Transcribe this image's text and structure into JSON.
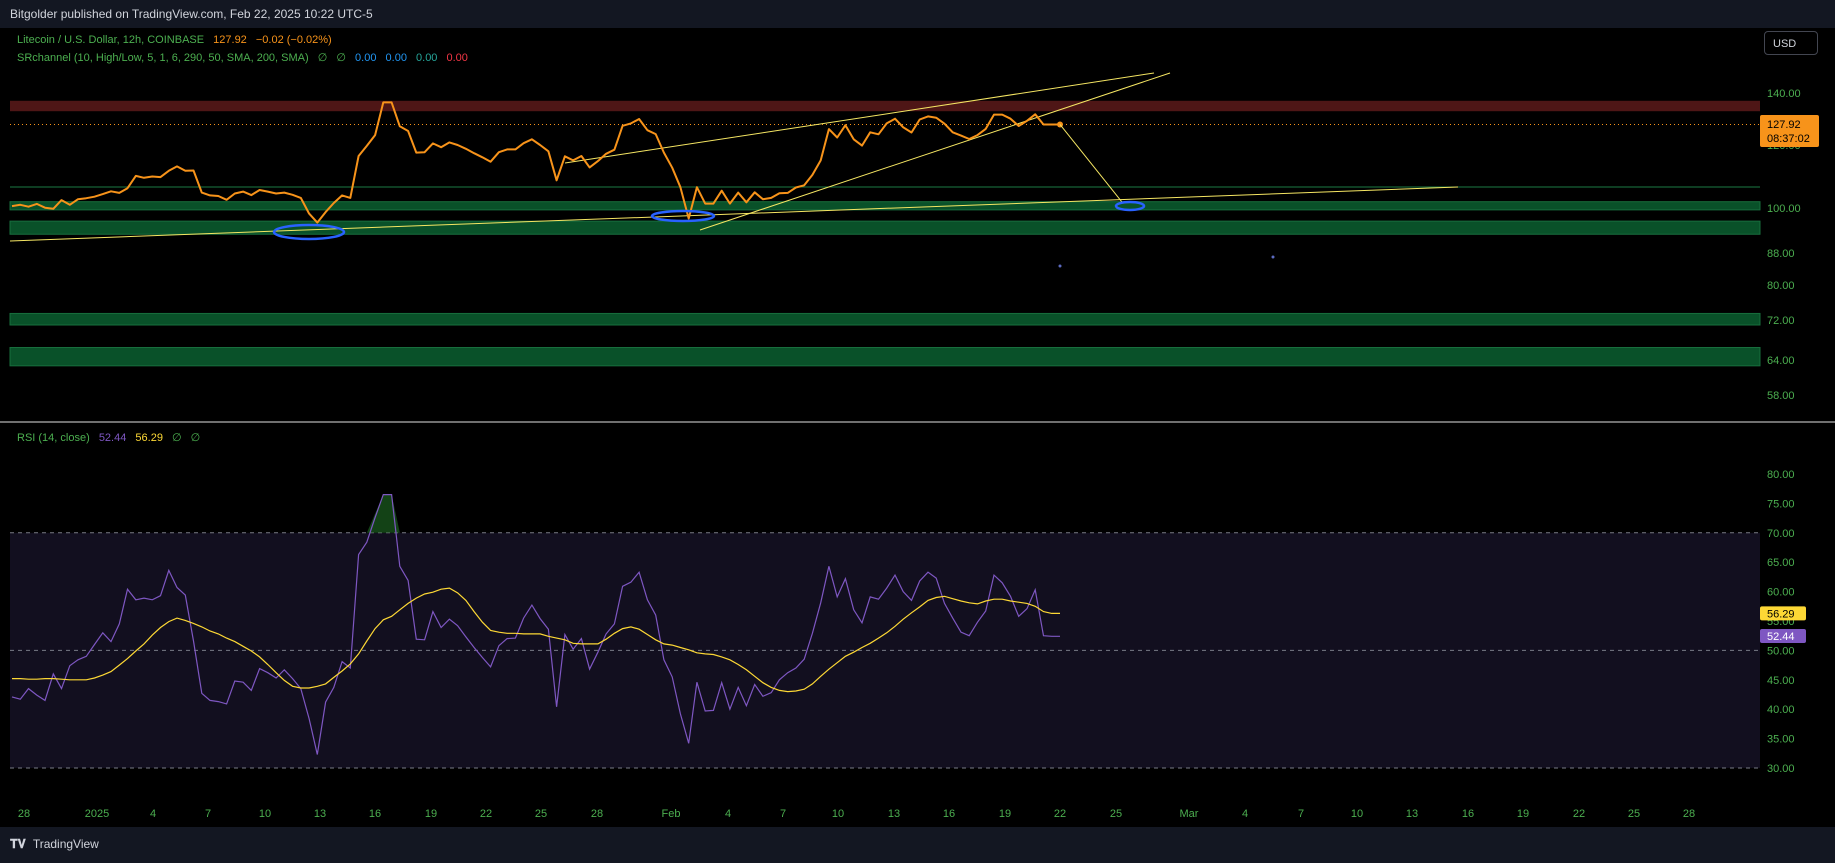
{
  "header": {
    "publisher": "Bitgolder published on TradingView.com, Feb 22, 2025 10:22 UTC-5"
  },
  "currency_button": "USD",
  "legend": {
    "symbol": "Litecoin / U.S. Dollar, 12h, COINBASE",
    "price": "127.92",
    "change": "−0.02 (−0.02%)",
    "indicator": "SRchannel (10, High/Low, 5, 1, 6, 290, 50, SMA, 200, SMA)",
    "indicator_values": [
      "0.00",
      "0.00",
      "0.00",
      "0.00"
    ],
    "rsi_label": "RSI (14, close)",
    "rsi_value": "52.44",
    "rsi_ma_value": "56.29",
    "empty_glyph": "∅"
  },
  "price_badge": {
    "price": "127.92",
    "countdown": "08:37:02"
  },
  "rsi_badges": {
    "ma": "56.29",
    "rsi": "52.44"
  },
  "colors": {
    "price_line": "#f7931a",
    "trendline": "#f5e663",
    "rsi_line": "#7e57c2",
    "rsi_ma": "#fdd835",
    "support_zone": "#0a5a2e",
    "resistance_zone": "#5c1a1a",
    "axis_text": "#4caf50",
    "ellipse": "#2962ff"
  },
  "footer": {
    "brand": "TradingView"
  },
  "chart_data": [
    {
      "type": "line",
      "title": "Litecoin / U.S. Dollar, 12h, COINBASE",
      "y_ticks": [
        "140.00",
        "120.00",
        "100.00",
        "88.00",
        "80.00",
        "72.00",
        "64.00",
        "58.00"
      ],
      "x_tick_labels": [
        "28",
        "2025",
        "4",
        "7",
        "10",
        "13",
        "16",
        "19",
        "22",
        "25",
        "28",
        "Feb",
        "4",
        "7",
        "10",
        "13",
        "16",
        "19",
        "22",
        "25",
        "Mar",
        "4",
        "7",
        "10",
        "13",
        "16",
        "19",
        "22",
        "25",
        "28"
      ],
      "series": [
        {
          "name": "Litecoin / U.S. Dollar",
          "values": [
            100.6,
            101.0,
            100.4,
            101.3,
            100.1,
            99.8,
            102.5,
            101.0,
            102.8,
            103.1,
            103.6,
            104.4,
            105.3,
            104.8,
            106.3,
            110.2,
            109.6,
            110.0,
            109.8,
            111.8,
            113.2,
            111.8,
            111.9,
            104.9,
            104.0,
            103.8,
            102.6,
            104.6,
            105.2,
            104.1,
            105.7,
            105.2,
            104.6,
            104.9,
            104.2,
            103.2,
            98.5,
            96.1,
            98.9,
            101.6,
            104.0,
            103.2,
            116.5,
            119.7,
            123.8,
            136.4,
            136.4,
            127.2,
            125.4,
            117.6,
            117.7,
            120.6,
            119.3,
            121.0,
            120.0,
            118.8,
            117.4,
            116.1,
            114.7,
            117.7,
            118.6,
            118.6,
            120.7,
            122.2,
            120.0,
            118.0,
            108.8,
            116.4,
            115.1,
            116.5,
            112.9,
            114.9,
            117.2,
            118.5,
            127.4,
            128.3,
            130.0,
            125.7,
            124.2,
            117.6,
            112.8,
            106.6,
            97.2,
            106.6,
            101.4,
            101.4,
            105.5,
            101.4,
            104.9,
            101.8,
            105.0,
            102.8,
            103.2,
            104.7,
            104.8,
            106.5,
            107.2,
            110.5,
            115.1,
            126.1,
            122.9,
            127.6,
            122.2,
            119.8,
            124.9,
            124.1,
            128.3,
            130.1,
            126.8,
            124.8,
            129.8,
            131.0,
            130.5,
            128.2,
            124.9,
            123.6,
            122.3,
            123.8,
            126.2,
            131.7,
            131.7,
            130.1,
            127.3,
            129.3,
            131.8,
            127.9,
            127.9,
            127.9
          ]
        },
        {
          "name": "SRchannel zones",
          "values": []
        }
      ],
      "resistance_zone": [
        133,
        137
      ],
      "support_zones": [
        [
          99.5,
          102
        ],
        [
          93,
          96.5
        ],
        [
          71,
          73.5
        ],
        [
          63,
          66.5
        ]
      ],
      "projection": {
        "from": 127.9,
        "to": 101.5
      },
      "ylim": [
        55,
        155
      ]
    },
    {
      "type": "line",
      "title": "RSI (14, close)",
      "y_ticks": [
        "80.00",
        "75.00",
        "70.00",
        "65.00",
        "60.00",
        "55.00",
        "50.00",
        "45.00",
        "40.00",
        "35.00",
        "30.00"
      ],
      "bands": [
        30,
        50,
        70
      ],
      "series": [
        {
          "name": "RSI",
          "values": [
            42.1,
            41.7,
            43.5,
            42.4,
            41.5,
            46.0,
            43.5,
            47.4,
            48.4,
            49.0,
            51.0,
            53.0,
            51.5,
            54.5,
            60.4,
            58.6,
            58.9,
            58.6,
            59.3,
            63.6,
            60.7,
            59.4,
            51.6,
            42.7,
            41.5,
            41.3,
            40.9,
            44.8,
            44.6,
            43.2,
            46.9,
            46.2,
            45.3,
            46.7,
            45.2,
            43.5,
            38.4,
            32.3,
            41.2,
            43.7,
            48.1,
            47.0,
            66.3,
            68.4,
            72.6,
            76.5,
            76.5,
            64.3,
            61.9,
            51.9,
            51.8,
            56.6,
            53.9,
            55.3,
            54.2,
            52.3,
            50.5,
            48.8,
            47.2,
            50.8,
            52.0,
            52.1,
            55.5,
            57.7,
            55.4,
            53.6,
            40.4,
            52.7,
            50.2,
            52.0,
            46.8,
            49.7,
            52.8,
            54.5,
            60.9,
            61.6,
            63.3,
            58.6,
            56.0,
            48.4,
            45.5,
            39.2,
            34.2,
            44.6,
            39.7,
            39.8,
            44.5,
            40.0,
            43.7,
            40.6,
            44.2,
            42.2,
            42.8,
            45.0,
            46.2,
            47.0,
            48.5,
            52.9,
            58.1,
            64.3,
            59.1,
            62.2,
            56.9,
            54.7,
            59.1,
            58.7,
            60.6,
            62.8,
            60.0,
            58.5,
            61.8,
            63.3,
            62.3,
            58.0,
            55.5,
            53.1,
            52.5,
            54.8,
            56.7,
            62.8,
            61.5,
            59.2,
            55.8,
            57.1,
            60.3,
            52.5,
            52.4,
            52.4
          ]
        },
        {
          "name": "RSI-based MA",
          "values": [
            45.2,
            45.2,
            45.1,
            45.1,
            45.2,
            45.2,
            45.1,
            45.0,
            45.0,
            45.0,
            45.3,
            45.8,
            46.4,
            47.5,
            48.6,
            49.9,
            51.1,
            52.6,
            53.9,
            54.9,
            55.5,
            55.1,
            54.6,
            54.0,
            53.3,
            52.8,
            52.1,
            51.5,
            50.7,
            49.9,
            48.9,
            47.6,
            46.2,
            44.9,
            43.9,
            43.6,
            43.6,
            43.9,
            44.3,
            45.4,
            46.5,
            47.7,
            49.4,
            51.6,
            53.7,
            55.2,
            55.8,
            56.9,
            58.0,
            58.9,
            59.6,
            59.9,
            60.4,
            60.6,
            59.8,
            58.5,
            56.6,
            54.8,
            53.4,
            53.1,
            52.9,
            52.9,
            52.8,
            52.8,
            52.8,
            52.4,
            52.1,
            51.8,
            51.2,
            51.1,
            51.1,
            51.1,
            51.9,
            52.9,
            53.7,
            54.0,
            53.6,
            52.7,
            51.8,
            51.1,
            50.9,
            50.5,
            50.1,
            49.6,
            49.4,
            49.3,
            48.9,
            48.4,
            47.6,
            46.7,
            45.6,
            44.5,
            43.7,
            43.2,
            43.0,
            43.1,
            43.4,
            44.3,
            45.6,
            46.8,
            47.9,
            49.0,
            49.7,
            50.5,
            51.2,
            52.1,
            53.0,
            54.1,
            55.3,
            56.4,
            57.4,
            58.5,
            59.0,
            59.2,
            58.8,
            58.4,
            58.1,
            57.9,
            58.4,
            58.7,
            58.7,
            58.4,
            58.2,
            58.0,
            57.5,
            56.6,
            56.3,
            56.3
          ]
        }
      ],
      "ylim": [
        28,
        82
      ]
    }
  ]
}
